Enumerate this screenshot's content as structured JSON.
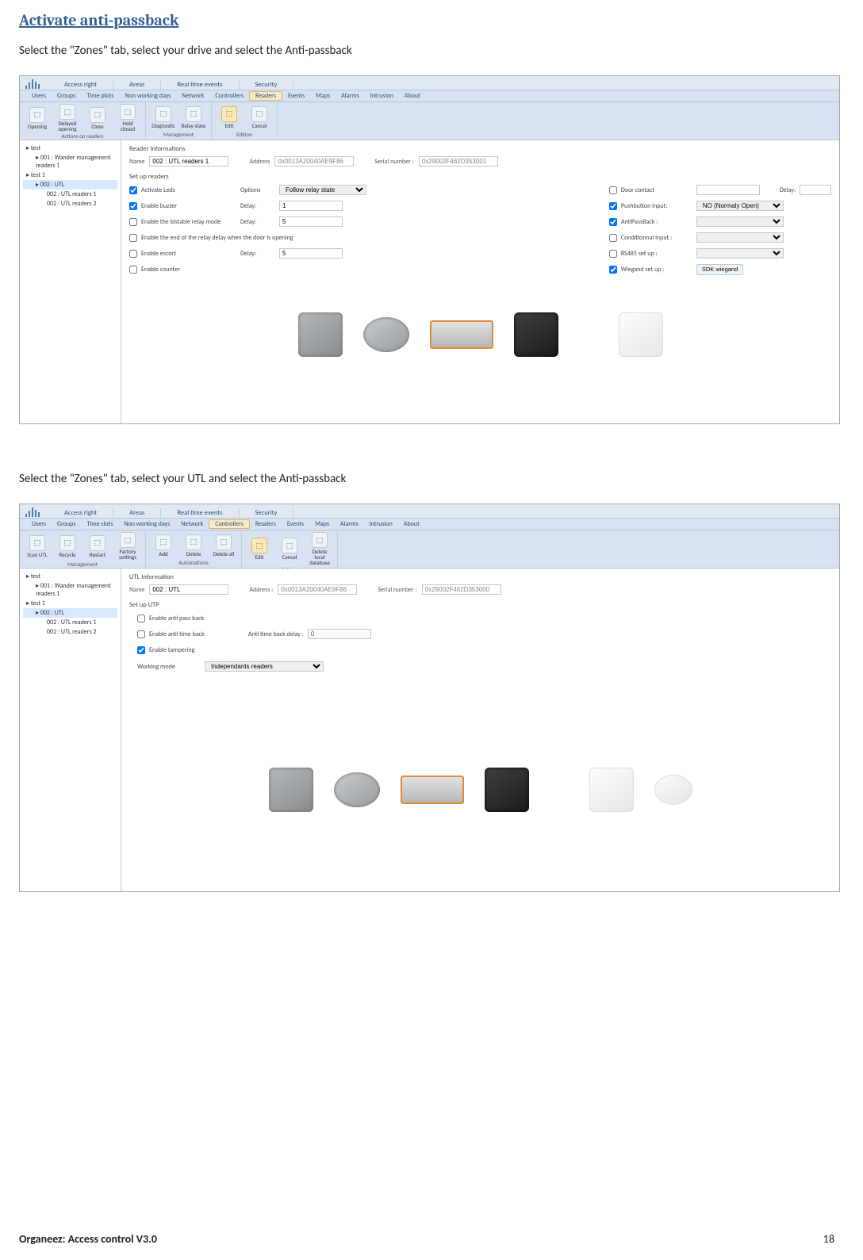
{
  "doc": {
    "title": "Activate anti-passback",
    "instruction1": "Select the \"Zones\" tab, select your drive and select the Anti-passback",
    "instruction2": "Select the \"Zones\" tab, select your UTL and select the Anti-passback",
    "footer_left": "Organeez: Access control     V3.0",
    "footer_right": "18"
  },
  "app1": {
    "top_tabs": [
      "Access right",
      "Areas",
      "Real time events",
      "Security"
    ],
    "sub_tabs": [
      "Users",
      "Groups",
      "Time plots",
      "Non working days",
      "Network",
      "Controllers",
      "Readers",
      "Events",
      "Maps",
      "Alarms",
      "Intrusion",
      "About"
    ],
    "sub_tab_selected": "Readers",
    "ribbon": {
      "groups": [
        {
          "label": "Actions on readers",
          "icons": [
            {
              "name": "opening",
              "label": "Opening"
            },
            {
              "name": "delayed-opening",
              "label": "Delayed opening"
            },
            {
              "name": "close",
              "label": "Close"
            },
            {
              "name": "hold-closed",
              "label": "Hold closed"
            }
          ]
        },
        {
          "label": "Management",
          "icons": [
            {
              "name": "diagnostic",
              "label": "Diagnostic"
            },
            {
              "name": "relay-state",
              "label": "Relay state"
            }
          ]
        },
        {
          "label": "Edition",
          "icons": [
            {
              "name": "edit",
              "label": "Edit",
              "selected": true
            },
            {
              "name": "cancel",
              "label": "Cancel"
            }
          ]
        }
      ]
    },
    "tree": [
      {
        "l": 1,
        "t": "test"
      },
      {
        "l": 2,
        "t": "001 : Wander management readers 1"
      },
      {
        "l": 1,
        "t": "test 1"
      },
      {
        "l": 2,
        "t": "002 : UTL",
        "sel": true
      },
      {
        "l": 3,
        "t": "002 : UTL readers 1"
      },
      {
        "l": 3,
        "t": "002 : UTL readers 2"
      }
    ],
    "reader_info_title": "Reader Informations",
    "name_label": "Name",
    "name_value": "002 : UTL readers 1",
    "address_label": "Address",
    "address_value": "0x0013A20040AE9F86",
    "serial_label": "Serial number :",
    "serial_value": "0x29002F462D353001",
    "setup_title": "Set up readers",
    "left_opts": [
      {
        "cb": true,
        "label": "Activate Leds",
        "mid": "Options",
        "input": "Follow relay state",
        "type": "select"
      },
      {
        "cb": true,
        "label": "Enable buzzer",
        "mid": "Delay:",
        "input": "1",
        "type": "text"
      },
      {
        "cb": false,
        "label": "Enable the bistable relay mode",
        "mid": "Delay:",
        "input": "5",
        "type": "text"
      },
      {
        "cb": false,
        "label": "Enable the end of the relay delay when the door is opening"
      },
      {
        "cb": false,
        "label": "Enable escort",
        "mid": "Delay:",
        "input": "5",
        "type": "text"
      },
      {
        "cb": false,
        "label": "Enable counter"
      }
    ],
    "right_opts": [
      {
        "cb": false,
        "label": "Door contact",
        "input": "",
        "extra": "Delay:"
      },
      {
        "cb": true,
        "label": "Pushbutton input:",
        "input": "NO (Normaly Open)",
        "type": "select"
      },
      {
        "cb": true,
        "label": "AntiPassBack :",
        "input": "",
        "type": "select"
      },
      {
        "cb": false,
        "label": "Conditionnal input :",
        "input": "",
        "type": "select"
      },
      {
        "cb": false,
        "label": "RS485 set up :",
        "input": "",
        "type": "select"
      },
      {
        "cb": true,
        "label": "Wiegand set up :",
        "btn": "SDK wiegand"
      }
    ]
  },
  "app2": {
    "top_tabs": [
      "Access right",
      "Areas",
      "Real time events",
      "Security"
    ],
    "sub_tabs": [
      "Users",
      "Groups",
      "Time slots",
      "Non working days",
      "Network",
      "Controllers",
      "Readers",
      "Events",
      "Maps",
      "Alarms",
      "Intrusion",
      "About"
    ],
    "sub_tab_selected": "Controllers",
    "ribbon": {
      "groups": [
        {
          "label": "Management",
          "icons": [
            {
              "name": "scan-utl",
              "label": "Scan UTL"
            },
            {
              "name": "recycle",
              "label": "Recycle"
            },
            {
              "name": "restart",
              "label": "Restart"
            },
            {
              "name": "factory",
              "label": "Factory settings"
            }
          ]
        },
        {
          "label": "Automatisms",
          "icons": [
            {
              "name": "add",
              "label": "Add"
            },
            {
              "name": "delete",
              "label": "Delete"
            },
            {
              "name": "delete-all",
              "label": "Delete all"
            }
          ]
        },
        {
          "label": "Edition",
          "icons": [
            {
              "name": "edit",
              "label": "Edit",
              "selected": true
            },
            {
              "name": "cancel",
              "label": "Cancel"
            },
            {
              "name": "delete-db",
              "label": "Delete local database"
            }
          ]
        }
      ]
    },
    "tree": [
      {
        "l": 1,
        "t": "test"
      },
      {
        "l": 2,
        "t": "001 : Wander management readers 1"
      },
      {
        "l": 1,
        "t": "test 1"
      },
      {
        "l": 2,
        "t": "002 : UTL",
        "sel": true
      },
      {
        "l": 3,
        "t": "002 : UTL readers 1"
      },
      {
        "l": 3,
        "t": "002 : UTL readers 2"
      }
    ],
    "utl_info_title": "UTL Information",
    "name_label": "Name",
    "name_value": "002 : UTL",
    "address_label": "Address :",
    "address_value": "0x0013A20040AE9F86",
    "serial_label": "Serial number :",
    "serial_value": "0x29002F462D353000",
    "setup_title": "Set up UTP",
    "opts": [
      {
        "cb": false,
        "label": "Enable anti pass back"
      },
      {
        "cb": false,
        "label": "Enable anti time back",
        "mid": "Anti time back delay :",
        "input": "0",
        "disabled": true
      },
      {
        "cb": true,
        "label": "Enable tampering"
      }
    ],
    "working_mode_label": "Working mode",
    "working_mode_value": "Independants readers"
  }
}
